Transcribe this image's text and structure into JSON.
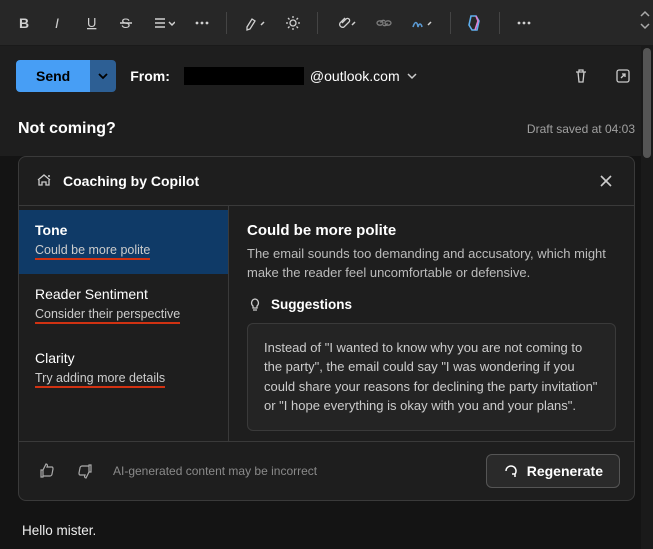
{
  "compose": {
    "send_label": "Send",
    "from_label": "From:",
    "from_email_domain": "@outlook.com",
    "subject": "Not coming?",
    "draft_saved": "Draft saved at 04:03"
  },
  "copilot": {
    "panel_title": "Coaching by Copilot",
    "tabs": [
      {
        "title": "Tone",
        "sub": "Could be more polite"
      },
      {
        "title": "Reader Sentiment",
        "sub": "Consider their perspective"
      },
      {
        "title": "Clarity",
        "sub": "Try adding more details"
      }
    ],
    "active_tab": 0,
    "main": {
      "heading": "Could be more polite",
      "description": "The email sounds too demanding and accusatory, which might make the reader feel uncomfortable or defensive.",
      "suggestions_label": "Suggestions",
      "suggestion_text": "Instead of \"I wanted to know why you are not coming to the party\", the email could say \"I was wondering if you could share your reasons for declining the party invitation\" or \"I hope everything is okay with you and your plans\"."
    },
    "footer": {
      "disclaimer": "AI-generated content may be incorrect",
      "regenerate_label": "Regenerate"
    }
  },
  "email_body": {
    "greeting": "Hello mister."
  }
}
